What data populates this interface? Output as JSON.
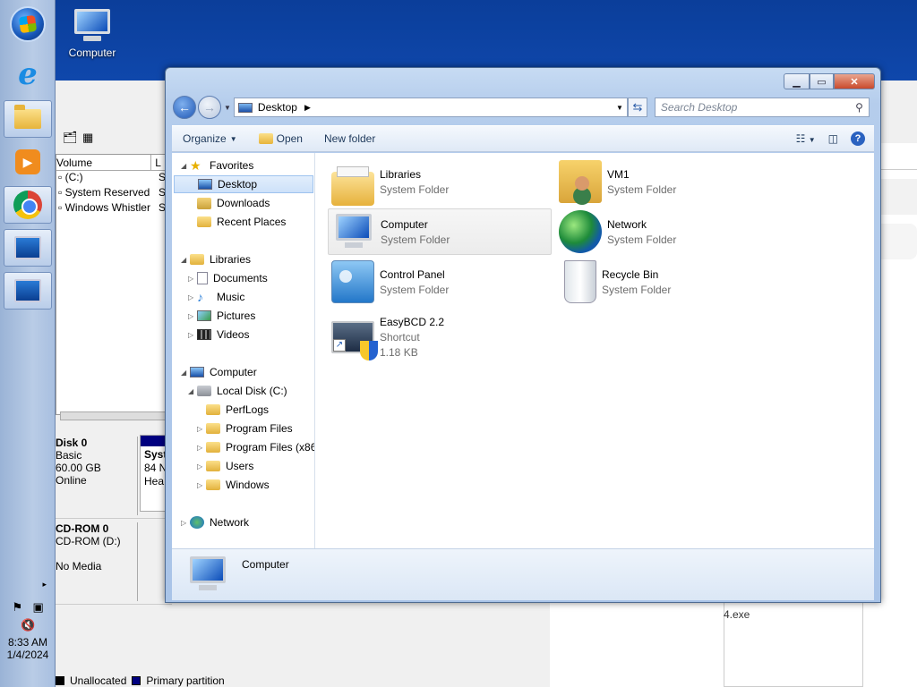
{
  "taskbar": {
    "buttons": [
      "start-orb",
      "internet-explorer",
      "windows-explorer",
      "media-player",
      "chrome",
      "network-computer",
      "computer-management"
    ],
    "clock_time": "8:33 AM",
    "clock_date": "1/4/2024"
  },
  "desktop": {
    "computer_label": "Computer"
  },
  "disk_management": {
    "columns": [
      "Volume",
      "L"
    ],
    "volumes": [
      {
        "name": "(C:)",
        "l": "Si"
      },
      {
        "name": "System Reserved",
        "l": "Si"
      },
      {
        "name": "Windows Whistler",
        "l": "Si"
      }
    ],
    "disk0": {
      "title": "Disk 0",
      "type": "Basic",
      "size": "60.00 GB",
      "status": "Online",
      "part_title": "Syst",
      "part_size": "84 N",
      "part_status": "Hea"
    },
    "cdrom0": {
      "title": "CD-ROM 0",
      "drive": "CD-ROM (D:)",
      "status": "No Media"
    },
    "legend": {
      "unallocated": "Unallocated",
      "primary": "Primary partition"
    },
    "colors": {
      "primary": "#000080",
      "unallocated": "#000000"
    },
    "exe_fragment": "4.exe"
  },
  "explorer": {
    "address": "Desktop",
    "search_placeholder": "Search Desktop",
    "commands": {
      "organize": "Organize",
      "open": "Open",
      "new_folder": "New folder"
    },
    "nav": {
      "favorites": "Favorites",
      "desktop": "Desktop",
      "downloads": "Downloads",
      "recent_places": "Recent Places",
      "libraries": "Libraries",
      "documents": "Documents",
      "music": "Music",
      "pictures": "Pictures",
      "videos": "Videos",
      "computer": "Computer",
      "local_disk": "Local Disk (C:)",
      "perflogs": "PerfLogs",
      "program_files": "Program Files",
      "program_files_x86": "Program Files (x86",
      "users": "Users",
      "windows": "Windows",
      "network": "Network"
    },
    "items": [
      {
        "name": "Libraries",
        "sub": "System Folder",
        "icon": "libraries-icon"
      },
      {
        "name": "VM1",
        "sub": "System Folder",
        "icon": "user-folder-icon"
      },
      {
        "name": "Computer",
        "sub": "System Folder",
        "icon": "computer-icon"
      },
      {
        "name": "Network",
        "sub": "System Folder",
        "icon": "network-icon"
      },
      {
        "name": "Control Panel",
        "sub": "System Folder",
        "icon": "control-panel-icon"
      },
      {
        "name": "Recycle Bin",
        "sub": "System Folder",
        "icon": "recycle-bin-icon"
      },
      {
        "name": "EasyBCD 2.2",
        "sub": "Shortcut",
        "size": "1.18 KB",
        "icon": "easybcd-icon"
      }
    ],
    "details_name": "Computer"
  }
}
